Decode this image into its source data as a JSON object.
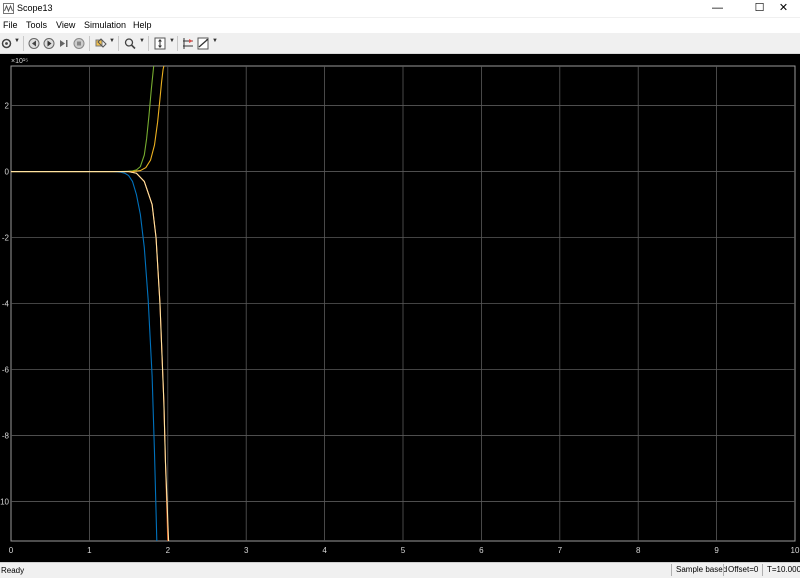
{
  "window": {
    "title": "Scope13"
  },
  "menu": [
    "File",
    "Tools",
    "View",
    "Simulation",
    "Help"
  ],
  "toolbar": [
    {
      "name": "settings-icon",
      "dropdown": true
    },
    {
      "name": "step-back-icon",
      "dropdown": false
    },
    {
      "name": "run-icon",
      "dropdown": false
    },
    {
      "name": "step-forward-icon",
      "dropdown": false
    },
    {
      "name": "stop-icon",
      "dropdown": false
    },
    {
      "name": "highlight-icon",
      "dropdown": true
    },
    {
      "name": "zoom-icon",
      "dropdown": true
    },
    {
      "name": "scale-axes-icon",
      "dropdown": true
    },
    {
      "name": "cursor-measurements-icon",
      "dropdown": false
    },
    {
      "name": "triggers-icon",
      "dropdown": true
    }
  ],
  "status": {
    "text": "Ready",
    "sample": "Sample based",
    "offset": "Offset=0",
    "time": "T=10.000"
  },
  "chart_data": {
    "type": "line",
    "background": "#000000",
    "grid": true,
    "exponent_label": "×10¹⁵",
    "xlim": [
      0,
      10
    ],
    "ylim": [
      -11.2,
      3.2
    ],
    "xticks": [
      0,
      1,
      2,
      3,
      4,
      5,
      6,
      7,
      8,
      9,
      10
    ],
    "xtick_labels": [
      "0",
      "1",
      "2",
      "3",
      "4",
      "5",
      "6",
      "7",
      "8",
      "9",
      "10"
    ],
    "yticks": [
      2,
      0,
      -2,
      -4,
      -6,
      -8,
      -10
    ],
    "ytick_labels": [
      "2",
      "0",
      "-2",
      "-4",
      "-6",
      "-8",
      "10"
    ],
    "series": [
      {
        "color": "#77ac30",
        "x": [
          0,
          1.4,
          1.5,
          1.55,
          1.6,
          1.65,
          1.7,
          1.73,
          1.76,
          1.79,
          1.82
        ],
        "y": [
          0,
          0,
          0.01,
          0.02,
          0.05,
          0.15,
          0.5,
          1.0,
          1.7,
          2.5,
          3.2
        ]
      },
      {
        "color": "#edb120",
        "x": [
          0,
          1.55,
          1.65,
          1.72,
          1.78,
          1.83,
          1.87,
          1.9,
          1.92,
          1.94,
          1.95
        ],
        "y": [
          0,
          0,
          0.03,
          0.12,
          0.35,
          0.8,
          1.5,
          2.2,
          2.7,
          3.1,
          3.2
        ]
      },
      {
        "color": "#0072bd",
        "x": [
          0,
          1.3,
          1.4,
          1.45,
          1.5,
          1.55,
          1.6,
          1.65,
          1.7,
          1.75,
          1.8,
          1.83,
          1.86
        ],
        "y": [
          0,
          0,
          -0.02,
          -0.05,
          -0.12,
          -0.3,
          -0.7,
          -1.3,
          -2.3,
          -3.9,
          -6.2,
          -8.5,
          -11.2
        ]
      },
      {
        "color": "#d95319",
        "x": [
          0,
          1.5,
          1.6,
          1.7,
          1.8,
          1.85,
          1.9,
          1.95,
          1.97,
          2.0
        ],
        "y": [
          0,
          0,
          -0.05,
          -0.3,
          -1.0,
          -2.0,
          -4.0,
          -7.0,
          -8.8,
          -11.2
        ]
      },
      {
        "color": "#ffe3a0",
        "x": [
          0,
          1.5,
          1.6,
          1.7,
          1.8,
          1.85,
          1.9,
          1.95,
          1.97,
          2.01
        ],
        "y": [
          0,
          0,
          -0.05,
          -0.3,
          -1.0,
          -2.0,
          -4.0,
          -7.0,
          -8.8,
          -11.2
        ]
      }
    ]
  }
}
